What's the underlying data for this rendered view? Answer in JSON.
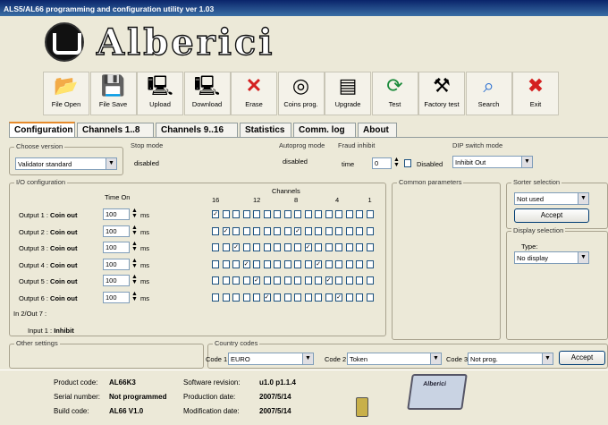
{
  "window": {
    "title": "ALS5/AL66 programming and configuration utility ver 1.03"
  },
  "logo": {
    "brand": "Alberici"
  },
  "toolbar": [
    {
      "label": "File Open",
      "icon": "folder-open-icon",
      "glyph": "📂"
    },
    {
      "label": "File Save",
      "icon": "floppy-disk-icon",
      "glyph": "💾"
    },
    {
      "label": "Upload",
      "icon": "upload-icon",
      "glyph": "🖳"
    },
    {
      "label": "Download",
      "icon": "download-icon",
      "glyph": "🖳"
    },
    {
      "label": "Erase",
      "icon": "erase-icon",
      "glyph": "✕"
    },
    {
      "label": "Coins prog.",
      "icon": "coins-prog-icon",
      "glyph": "◎"
    },
    {
      "label": "Upgrade",
      "icon": "upgrade-icon",
      "glyph": "▤"
    },
    {
      "label": "Test",
      "icon": "test-icon",
      "glyph": "⟳"
    },
    {
      "label": "Factory test",
      "icon": "factory-test-icon",
      "glyph": "⚒"
    },
    {
      "label": "Search",
      "icon": "search-icon",
      "glyph": "⌕"
    },
    {
      "label": "Exit",
      "icon": "exit-icon",
      "glyph": "✖"
    }
  ],
  "tabs": [
    "Configuration",
    "Channels 1..8",
    "Channels 9..16",
    "Statistics",
    "Comm. log",
    "About"
  ],
  "config": {
    "choose_version": {
      "label": "Choose version",
      "value": "Validator standard"
    },
    "stop_mode": {
      "label": "Stop mode",
      "value": "disabled"
    },
    "autoprog_mode": {
      "label": "Autoprog mode",
      "value": "disabled"
    },
    "fraud_inhibit": {
      "label": "Fraud inhibit",
      "time_label": "time",
      "time_value": "0",
      "checkbox_label": "Disabled"
    },
    "dip_switch_mode": {
      "label": "DIP switch mode",
      "value": "Inhibit Out"
    },
    "io": {
      "label": "I/O configuration",
      "time_on_label": "Time On",
      "channels_label": "Channels",
      "channel_ticks": [
        "16",
        "12",
        "8",
        "4",
        "1"
      ],
      "unit": "ms",
      "outputs": [
        {
          "prefix": "Output 1 :",
          "name": "Coin out",
          "time": "100",
          "checked": [
            16
          ]
        },
        {
          "prefix": "Output 2 :",
          "name": "Coin out",
          "time": "100",
          "checked": [
            8,
            15
          ]
        },
        {
          "prefix": "Output 3 :",
          "name": "Coin out",
          "time": "100",
          "checked": [
            7,
            14
          ]
        },
        {
          "prefix": "Output 4 :",
          "name": "Coin out",
          "time": "100",
          "checked": [
            6,
            13
          ]
        },
        {
          "prefix": "Output 5 :",
          "name": "Coin out",
          "time": "100",
          "checked": [
            5,
            12
          ]
        },
        {
          "prefix": "Output 6 :",
          "name": "Coin out",
          "time": "100",
          "checked": [
            4,
            11
          ]
        }
      ],
      "in2out7": "In 2/Out 7 :",
      "input1_prefix": "Input 1 :",
      "input1_value": "Inhibit"
    },
    "common_parameters": {
      "label": "Common parameters"
    },
    "sorter": {
      "label": "Sorter selection",
      "value": "Not used",
      "accept": "Accept"
    },
    "display": {
      "label": "Display selection",
      "type_label": "Type:",
      "value": "No display"
    },
    "other_settings": {
      "label": "Other settings"
    },
    "country": {
      "label": "Country codes",
      "code1_label": "Code 1",
      "code1_value": "EURO",
      "code2_label": "Code 2",
      "code2_value": "Token",
      "code3_label": "Code 3",
      "code3_value": "Not prog.",
      "accept": "Accept"
    }
  },
  "status": {
    "product_code_label": "Product code:",
    "product_code": "AL66K3",
    "serial_label": "Serial number:",
    "serial": "Not programmed",
    "build_label": "Build code:",
    "build": "AL66 V1.0",
    "sw_label": "Software revision:",
    "sw": "u1.0 p1.1.4",
    "prod_date_label": "Production date:",
    "prod_date": "2007/5/14",
    "mod_date_label": "Modification date:",
    "mod_date": "2007/5/14",
    "device_brand": "Alberici"
  },
  "colors": {
    "title_bar": "#0a246a",
    "tab_accent": "#e68b2c",
    "check": "#1c5180",
    "erase_red": "#d42020"
  }
}
